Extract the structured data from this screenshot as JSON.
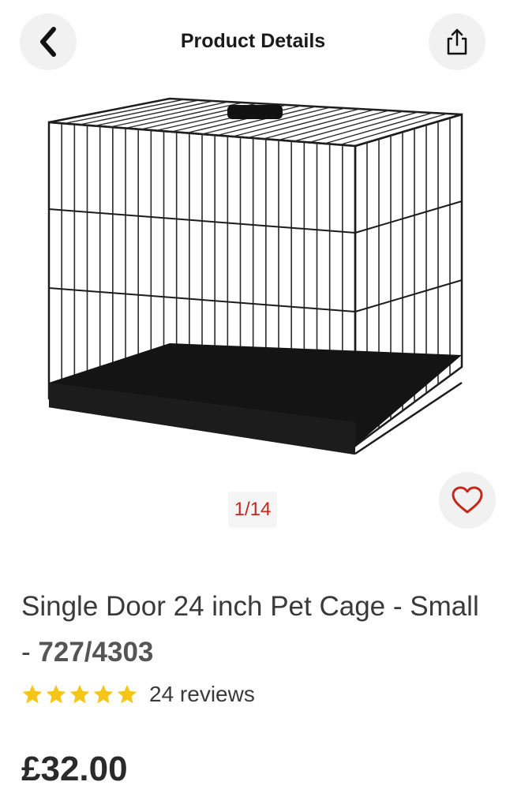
{
  "header": {
    "title": "Product Details"
  },
  "gallery": {
    "counter": "1/14"
  },
  "product": {
    "name": "Single Door 24 inch Pet Cage - Small - ",
    "sku": "727/4303",
    "rating_stars": 5,
    "reviews": "24 reviews",
    "price": "£32.00"
  },
  "colors": {
    "accent": "#c4281b",
    "star": "#f5c518"
  },
  "icons": {
    "back": "chevron-left-icon",
    "share": "share-icon",
    "favourite": "heart-icon",
    "star": "star-icon"
  }
}
